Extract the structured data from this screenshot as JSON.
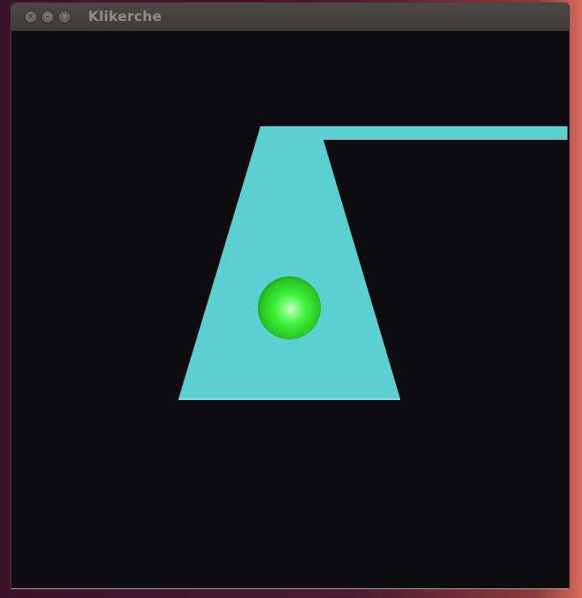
{
  "window": {
    "title": "Klikerche",
    "buttons": {
      "close_glyph": "×",
      "minimize_glyph": "–",
      "maximize_glyph": "□"
    }
  },
  "scene": {
    "background_color": "#0d0d0f",
    "platform_color": "#5ccfd1",
    "platform_edge_color": "#7fe6e8",
    "ball_color": "#3ef03a",
    "ball_highlight_color": "#e9ffe9"
  }
}
